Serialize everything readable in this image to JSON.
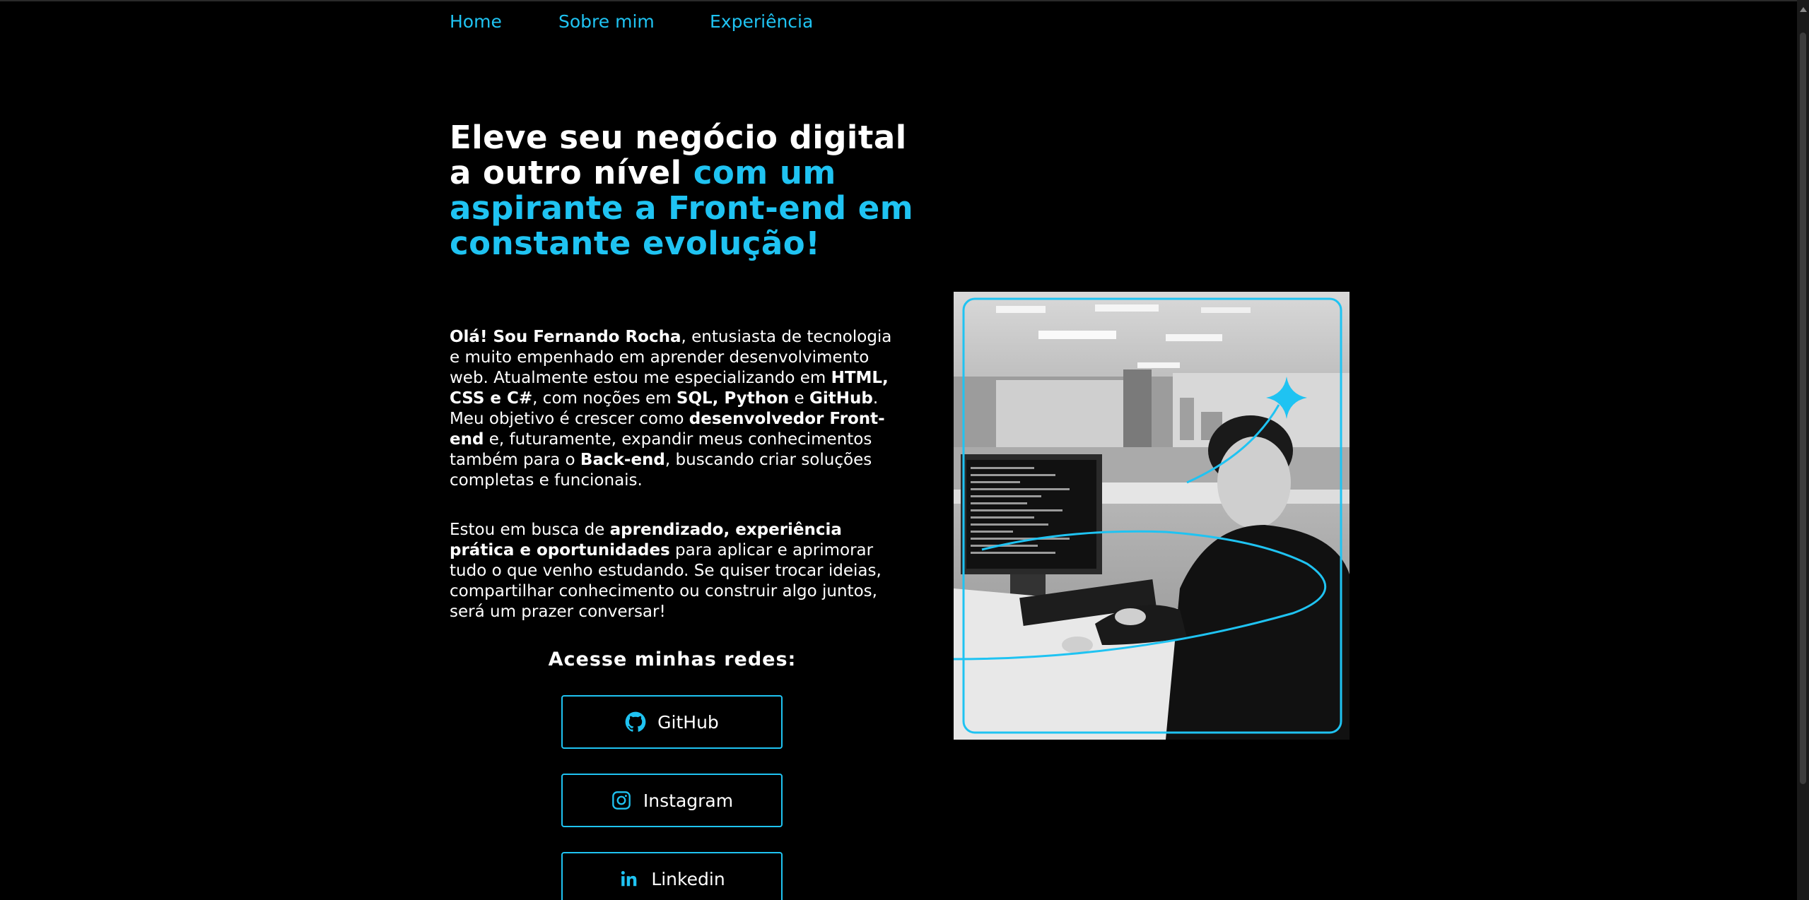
{
  "nav": {
    "home": "Home",
    "about": "Sobre mim",
    "experience": "Experiência"
  },
  "hero": {
    "title_plain": "Eleve seu negócio digital a outro nível ",
    "title_accent": "com um aspirante a Front-end em constante evolução!"
  },
  "intro": {
    "p1": [
      {
        "t": "Olá! Sou Fernando Rocha",
        "b": true
      },
      {
        "t": ", entusiasta de tecnologia e muito empenhado em aprender desenvolvimento web. Atualmente estou me especializando em ",
        "b": false
      },
      {
        "t": "HTML, CSS e C#",
        "b": true
      },
      {
        "t": ", com noções em ",
        "b": false
      },
      {
        "t": "SQL, Python",
        "b": true
      },
      {
        "t": " e ",
        "b": false
      },
      {
        "t": "GitHub",
        "b": true
      },
      {
        "t": ". Meu objetivo é crescer como ",
        "b": false
      },
      {
        "t": "desenvolvedor Front-end",
        "b": true
      },
      {
        "t": " e, futuramente, expandir meus conhecimentos também para o ",
        "b": false
      },
      {
        "t": "Back-end",
        "b": true
      },
      {
        "t": ", buscando criar soluções completas e funcionais.",
        "b": false
      }
    ],
    "p2": [
      {
        "t": "Estou em busca de ",
        "b": false
      },
      {
        "t": "aprendizado, experiência prática e oportunidades",
        "b": true
      },
      {
        "t": " para aplicar e aprimorar tudo o que venho estudando. Se quiser trocar ideias, compartilhar conhecimento ou construir algo juntos, será um prazer conversar!",
        "b": false
      }
    ]
  },
  "social": {
    "heading": "Acesse minhas redes:",
    "github": {
      "label": "GitHub",
      "icon": "github-icon"
    },
    "instagram": {
      "label": "Instagram",
      "icon": "instagram-icon"
    },
    "linkedin": {
      "label": "Linkedin",
      "icon": "linkedin-icon"
    }
  },
  "colors": {
    "accent": "#1fc3f2",
    "background": "#000000",
    "text": "#ffffff"
  }
}
